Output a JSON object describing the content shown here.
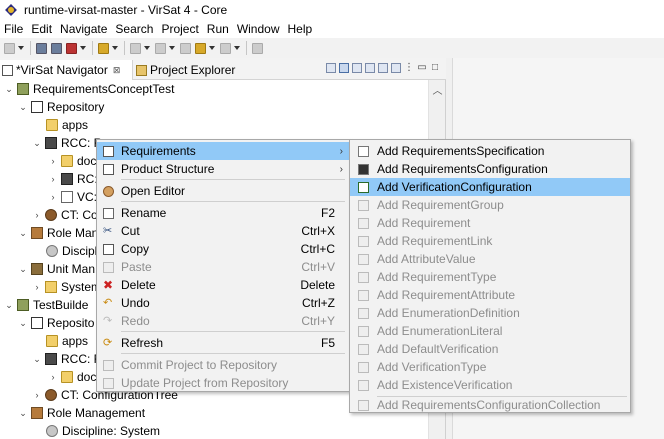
{
  "window": {
    "title": "runtime-virsat-master - VirSat 4 - Core"
  },
  "menubar": [
    "File",
    "Edit",
    "Navigate",
    "Search",
    "Project",
    "Run",
    "Window",
    "Help"
  ],
  "tabs": {
    "navigator": "*VirSat Navigator",
    "navigator_close": "⊠",
    "explorer": "Project Explorer"
  },
  "tree": [
    {
      "label": "RequirementsConceptTest",
      "icon": "project-icon"
    },
    {
      "label": "Repository",
      "icon": "repository-icon"
    },
    {
      "label": "apps",
      "icon": "folder-icon"
    },
    {
      "label": "RCC: R",
      "icon": "rcc-icon"
    },
    {
      "label": "doc",
      "icon": "folder-icon"
    },
    {
      "label": "RC:",
      "icon": "rc-icon"
    },
    {
      "label": "VC:",
      "icon": "vc-icon"
    },
    {
      "label": "CT: Co",
      "icon": "gear-icon"
    },
    {
      "label": "Role Man",
      "icon": "role-icon"
    },
    {
      "label": "Discipl",
      "icon": "discipline-icon"
    },
    {
      "label": "Unit Man",
      "icon": "unit-icon"
    },
    {
      "label": "System",
      "icon": "system-icon"
    },
    {
      "label": "TestBuilde",
      "icon": "project-icon"
    },
    {
      "label": "Reposito",
      "icon": "repository-icon"
    },
    {
      "label": "apps",
      "icon": "folder-icon"
    },
    {
      "label": "RCC: R",
      "icon": "rcc-icon"
    },
    {
      "label": "doc",
      "icon": "folder-icon"
    },
    {
      "label": "CT: ConfigurationTree",
      "icon": "gear-icon"
    },
    {
      "label": "Role Management",
      "icon": "role-icon"
    },
    {
      "label": "Discipline: System",
      "icon": "discipline-icon"
    }
  ],
  "context_menu": {
    "items": [
      {
        "label": "Requirements",
        "accel": "",
        "submenu": true,
        "enabled": true,
        "icon": "requirements-icon"
      },
      {
        "label": "Product Structure",
        "accel": "",
        "submenu": true,
        "enabled": true,
        "icon": "product-structure-icon"
      },
      {
        "label": "Open Editor",
        "accel": "",
        "submenu": false,
        "enabled": true,
        "icon": "open-editor-icon"
      },
      {
        "label": "Rename",
        "accel": "F2",
        "submenu": false,
        "enabled": true,
        "icon": "rename-icon"
      },
      {
        "label": "Cut",
        "accel": "Ctrl+X",
        "submenu": false,
        "enabled": true,
        "icon": "cut-icon"
      },
      {
        "label": "Copy",
        "accel": "Ctrl+C",
        "submenu": false,
        "enabled": true,
        "icon": "copy-icon"
      },
      {
        "label": "Paste",
        "accel": "Ctrl+V",
        "submenu": false,
        "enabled": false,
        "icon": "paste-icon"
      },
      {
        "label": "Delete",
        "accel": "Delete",
        "submenu": false,
        "enabled": true,
        "icon": "delete-icon"
      },
      {
        "label": "Undo",
        "accel": "Ctrl+Z",
        "submenu": false,
        "enabled": true,
        "icon": "undo-icon"
      },
      {
        "label": "Redo",
        "accel": "Ctrl+Y",
        "submenu": false,
        "enabled": false,
        "icon": "redo-icon"
      },
      {
        "label": "Refresh",
        "accel": "F5",
        "submenu": false,
        "enabled": true,
        "icon": "refresh-icon"
      },
      {
        "label": "Commit Project to Repository",
        "accel": "",
        "submenu": false,
        "enabled": false,
        "icon": "commit-icon"
      },
      {
        "label": "Update Project from Repository",
        "accel": "",
        "submenu": false,
        "enabled": false,
        "icon": "update-icon"
      }
    ],
    "selected": "Requirements"
  },
  "submenu": {
    "items": [
      {
        "label": "Add RequirementsSpecification",
        "enabled": true
      },
      {
        "label": "Add RequirementsConfiguration",
        "enabled": true
      },
      {
        "label": "Add VerificationConfiguration",
        "enabled": true
      },
      {
        "label": "Add RequirementGroup",
        "enabled": false
      },
      {
        "label": "Add Requirement",
        "enabled": false
      },
      {
        "label": "Add RequirementLink",
        "enabled": false
      },
      {
        "label": "Add AttributeValue",
        "enabled": false
      },
      {
        "label": "Add RequirementType",
        "enabled": false
      },
      {
        "label": "Add RequirementAttribute",
        "enabled": false
      },
      {
        "label": "Add EnumerationDefinition",
        "enabled": false
      },
      {
        "label": "Add EnumerationLiteral",
        "enabled": false
      },
      {
        "label": "Add DefaultVerification",
        "enabled": false
      },
      {
        "label": "Add VerificationType",
        "enabled": false
      },
      {
        "label": "Add ExistenceVerification",
        "enabled": false
      },
      {
        "label": "Add RequirementsConfigurationCollection",
        "enabled": false
      }
    ],
    "selected": "Add VerificationConfiguration"
  },
  "colors": {
    "selection": "#91c9f7",
    "menu_background": "#f2f2f2",
    "disabled_text": "#8d8d8d"
  }
}
